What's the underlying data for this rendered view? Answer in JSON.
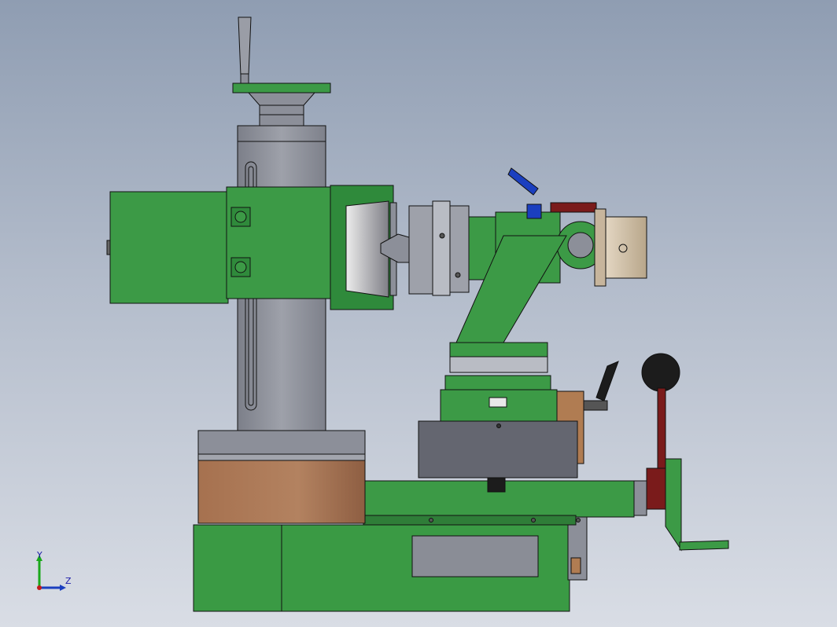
{
  "viewport": {
    "background": [
      "#8f9db2",
      "#d9dde5"
    ],
    "model": "tool-and-cutter-grinder-assembly"
  },
  "colors": {
    "green": "#3c9a46",
    "green_dark": "#2e7f37",
    "steel": "#8c8f99",
    "steel_light": "#b9bcc4",
    "bronze": "#9e6a4a",
    "tan": "#cfc0a8",
    "red": "#7a1b1b",
    "blue": "#1b3fbf",
    "black": "#1c1c1c",
    "outline": "#111111"
  },
  "axis_triad": {
    "y_label": "Y",
    "z_label": "Z"
  }
}
